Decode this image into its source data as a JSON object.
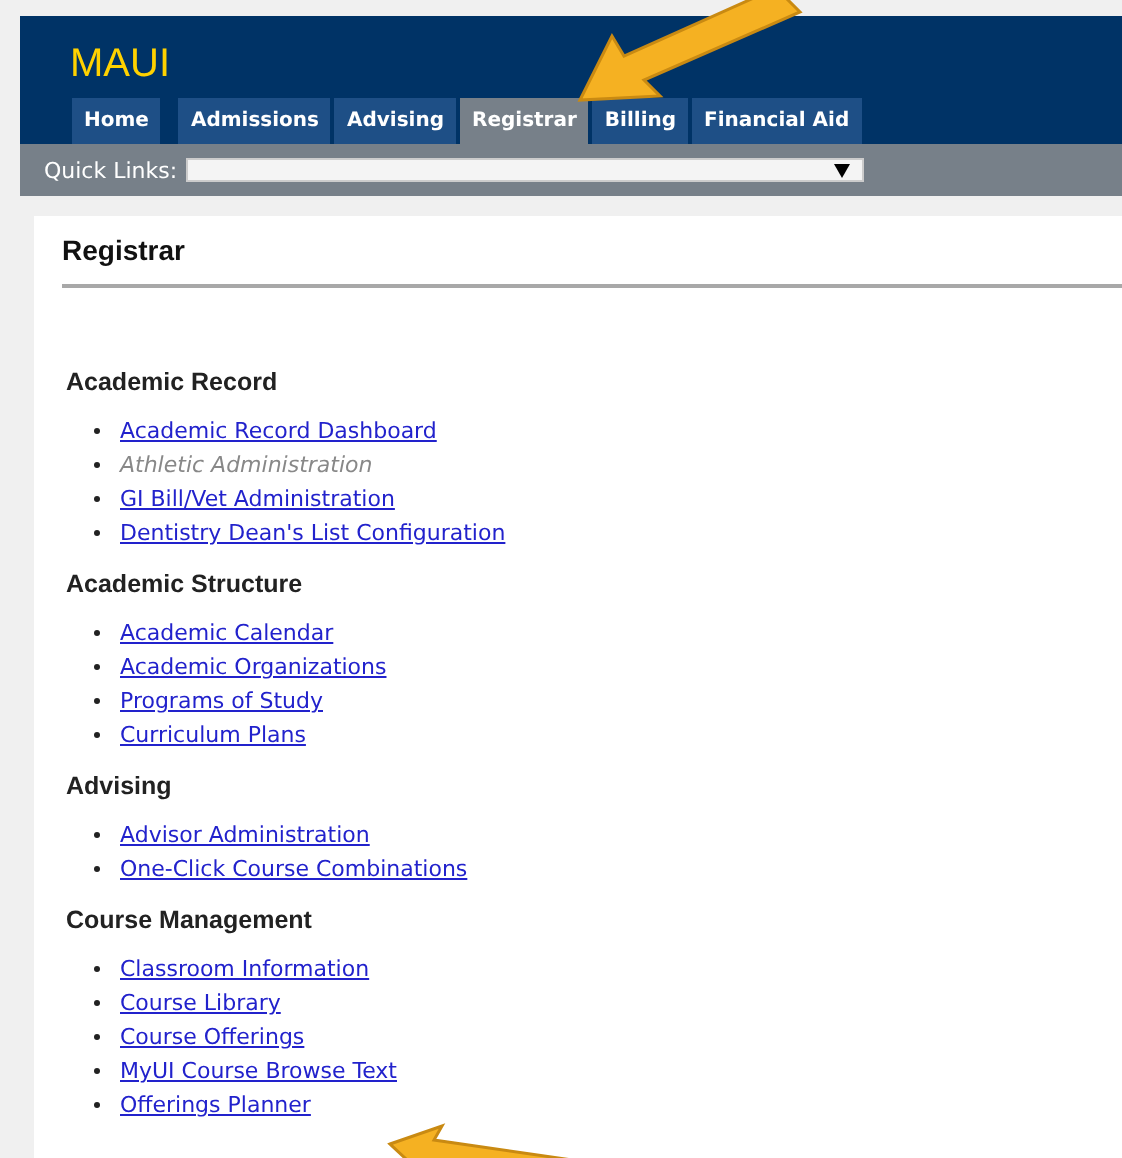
{
  "app": {
    "title": "MAUI"
  },
  "tabs": [
    {
      "label": "Home",
      "selected": false
    },
    {
      "label": "Admissions",
      "selected": false
    },
    {
      "label": "Advising",
      "selected": false
    },
    {
      "label": "Registrar",
      "selected": true
    },
    {
      "label": "Billing",
      "selected": false
    },
    {
      "label": "Financial Aid",
      "selected": false
    }
  ],
  "quick_links": {
    "label": "Quick Links:"
  },
  "page": {
    "title": "Registrar"
  },
  "sections": [
    {
      "heading": "Academic Record",
      "links": [
        {
          "label": "Academic Record Dashboard",
          "disabled": false
        },
        {
          "label": "Athletic Administration",
          "disabled": true
        },
        {
          "label": "GI Bill/Vet Administration",
          "disabled": false
        },
        {
          "label": "Dentistry Dean's List Configuration",
          "disabled": false
        }
      ]
    },
    {
      "heading": "Academic Structure",
      "links": [
        {
          "label": "Academic Calendar",
          "disabled": false
        },
        {
          "label": "Academic Organizations",
          "disabled": false
        },
        {
          "label": "Programs of Study",
          "disabled": false
        },
        {
          "label": "Curriculum Plans",
          "disabled": false
        }
      ]
    },
    {
      "heading": "Advising",
      "links": [
        {
          "label": "Advisor Administration",
          "disabled": false
        },
        {
          "label": "One-Click Course Combinations",
          "disabled": false
        }
      ]
    },
    {
      "heading": "Course Management",
      "links": [
        {
          "label": "Classroom Information",
          "disabled": false
        },
        {
          "label": "Course Library",
          "disabled": false
        },
        {
          "label": "Course Offerings",
          "disabled": false
        },
        {
          "label": "MyUI Course Browse Text",
          "disabled": false
        },
        {
          "label": "Offerings Planner",
          "disabled": false
        }
      ]
    }
  ]
}
